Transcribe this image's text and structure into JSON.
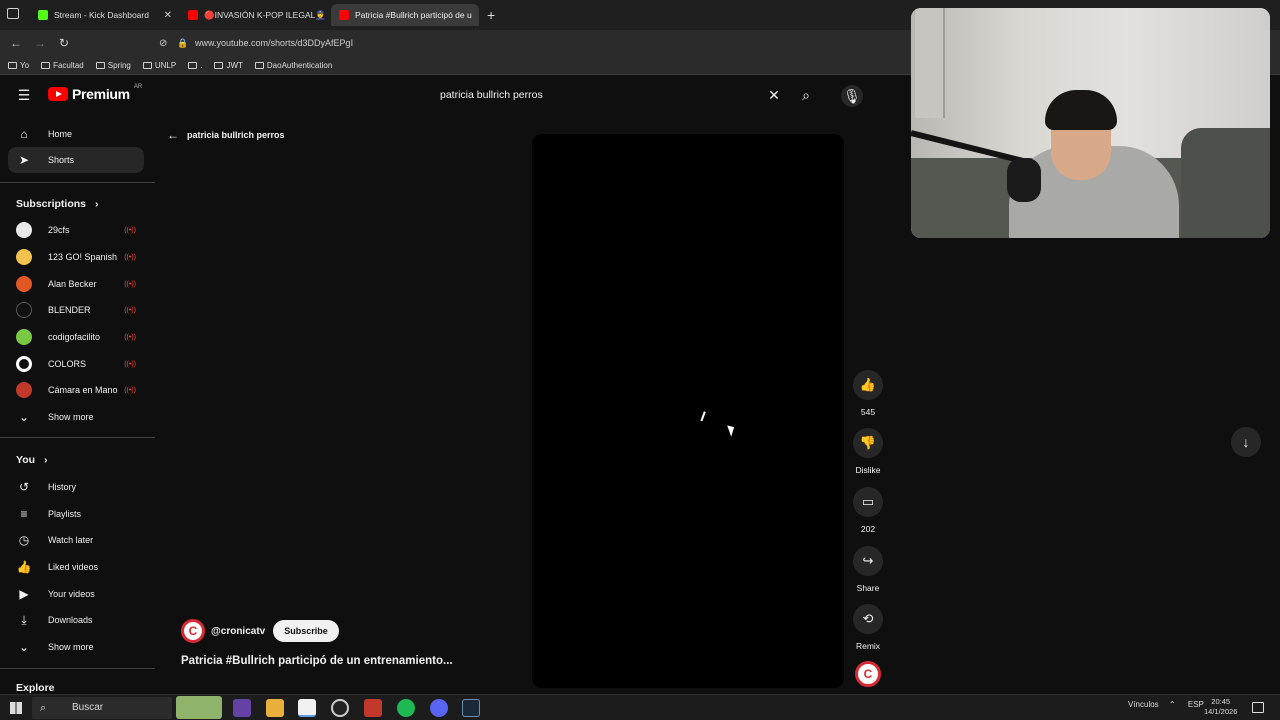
{
  "browser": {
    "tabs": [
      {
        "label": "Stream - Kick Dashboard",
        "favicon_color": "#53fc18"
      },
      {
        "label": "🔴INVASIÓN K-POP ILEGAL👮",
        "favicon_color": "#ff0000"
      },
      {
        "label": "Patricia #Bullrich participó de u",
        "favicon_color": "#ff0000"
      }
    ],
    "new_tab_label": "+",
    "url": "www.youtube.com/shorts/d3DDyAfEPgI",
    "bookmarks": [
      "Yo",
      "Facultad",
      "Spring",
      "UNLP",
      ".",
      "JWT",
      "DaoAuthentication"
    ]
  },
  "youtube": {
    "logo_text": "Premium",
    "country_code": "AR",
    "search_value": "patricia bullrich perros",
    "sidebar": {
      "main": [
        {
          "label": "Home",
          "icon": "home-icon"
        },
        {
          "label": "Shorts",
          "icon": "shorts-icon"
        }
      ],
      "subscriptions_header": "Subscriptions",
      "subscriptions": [
        {
          "label": "29cfs",
          "avatar_color": "#e8e8e8"
        },
        {
          "label": "123 GO! Spanish",
          "avatar_color": "#f2c14e"
        },
        {
          "label": "Alan Becker",
          "avatar_color": "#e25822"
        },
        {
          "label": "BLENDER",
          "avatar_color": "#111111"
        },
        {
          "label": "codigofacilito",
          "avatar_color": "#7ac943"
        },
        {
          "label": "COLORS",
          "avatar_color": "#ffffff"
        },
        {
          "label": "Cámara en Mano",
          "avatar_color": "#c0392b"
        }
      ],
      "show_more_1": "Show more",
      "you_header": "You",
      "you": [
        {
          "label": "History",
          "icon": "history-icon"
        },
        {
          "label": "Playlists",
          "icon": "playlists-icon"
        },
        {
          "label": "Watch later",
          "icon": "clock-icon"
        },
        {
          "label": "Liked videos",
          "icon": "thumb-up-icon"
        },
        {
          "label": "Your videos",
          "icon": "video-icon"
        },
        {
          "label": "Downloads",
          "icon": "download-icon"
        }
      ],
      "show_more_2": "Show more",
      "explore_header": "Explore"
    },
    "shorts": {
      "back_label": "patricia bullrich perros",
      "channel": "@cronicatv",
      "subscribe": "Subscribe",
      "title": "Patricia #Bullrich participó de un entrenamiento...",
      "actions": [
        {
          "label": "545",
          "icon": "thumb-up-icon"
        },
        {
          "label": "Dislike",
          "icon": "thumb-down-icon"
        },
        {
          "label": "202",
          "icon": "comment-icon"
        },
        {
          "label": "Share",
          "icon": "share-icon"
        },
        {
          "label": "Remix",
          "icon": "remix-icon"
        }
      ]
    }
  },
  "taskbar": {
    "search_placeholder": "Buscar",
    "tray_label": "Vínculos",
    "lang": "ESP",
    "time": "20:45",
    "date": "14/1/2026"
  }
}
